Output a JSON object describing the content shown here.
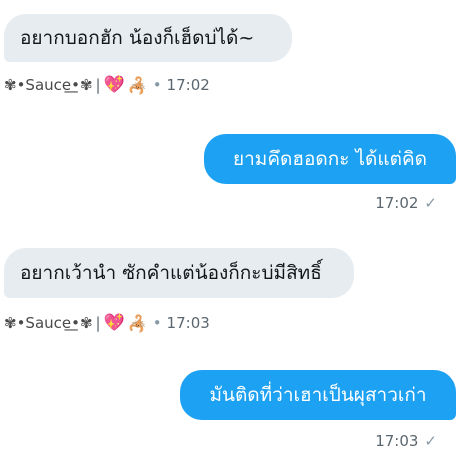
{
  "messages": [
    {
      "direction": "in",
      "text": "อยากบอกฮัก น้องก็เฮ็ดบ่ได้~",
      "sender": "✾•Sauce͟•✾",
      "time": "17:02"
    },
    {
      "direction": "out",
      "text": "ยามคึดฮอดกะ ได้แต่คิด",
      "time": "17:02"
    },
    {
      "direction": "in",
      "text": "อยากเว้านำ ซักคำแต่น้องก็กะบ่มีสิทธิ์",
      "sender": "✾•Sauce͟•✾",
      "time": "17:03"
    },
    {
      "direction": "out",
      "text": "มันติดที่ว่าเฮาเป็นผุสาวเก่า",
      "time": "17:03"
    }
  ],
  "sender_decor": {
    "bar": "|",
    "heart": "💖",
    "scorpion": "🦂",
    "dot": "•"
  },
  "check_icon": "✓",
  "colors": {
    "incoming_bg": "#e6ecf0",
    "outgoing_bg": "#1da1f2",
    "meta_text": "#5b6770"
  }
}
